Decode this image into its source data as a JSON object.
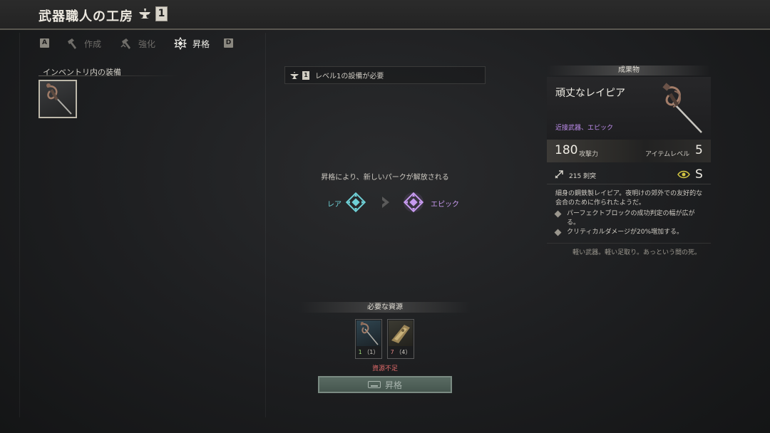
{
  "header": {
    "title": "武器職人の工房",
    "level": "1"
  },
  "tabs": {
    "left_key": "A",
    "right_key": "D",
    "items": [
      {
        "label": "作成",
        "state": "inactive"
      },
      {
        "label": "強化",
        "state": "inactive"
      },
      {
        "label": "昇格",
        "state": "active"
      }
    ]
  },
  "inventory": {
    "title": "インベントリ内の装備"
  },
  "center": {
    "requirement_level": "1",
    "requirement_text": "レベル1の設備が必要",
    "unlock_text": "昇格により、新しいパークが解放される",
    "from_rarity": "レア",
    "to_rarity": "エピック",
    "resources_title": "必要な資源",
    "resources": [
      {
        "have": "1",
        "need": "（1）",
        "status": "ok"
      },
      {
        "have": "7",
        "need": "（4）",
        "status": "bad"
      }
    ],
    "insufficient_text": "資源不足",
    "ascend_button": "昇格"
  },
  "result": {
    "header": "成果物",
    "name": "頑丈なレイピア",
    "type": "近接武器、エピック",
    "attack_value": "180",
    "attack_label": "攻撃力",
    "item_level_label": "アイテムレベル",
    "item_level_value": "5",
    "pierce_text": "215 刺突",
    "grade": "S",
    "description": "細身の鋼鉄製レイピア。夜明けの郊外での友好的な会合のために作られたようだ。",
    "perks": [
      "パーフェクトブロックの成功判定の幅が広がる。",
      "クリティカルダメージが20%増加する。"
    ],
    "flavor": "軽い武器。軽い足取り。あっという間の死。"
  },
  "colors": {
    "rare": "#6fd0d6",
    "epic": "#c79af0",
    "warning": "#e06a6a",
    "button": "#4f6159"
  }
}
